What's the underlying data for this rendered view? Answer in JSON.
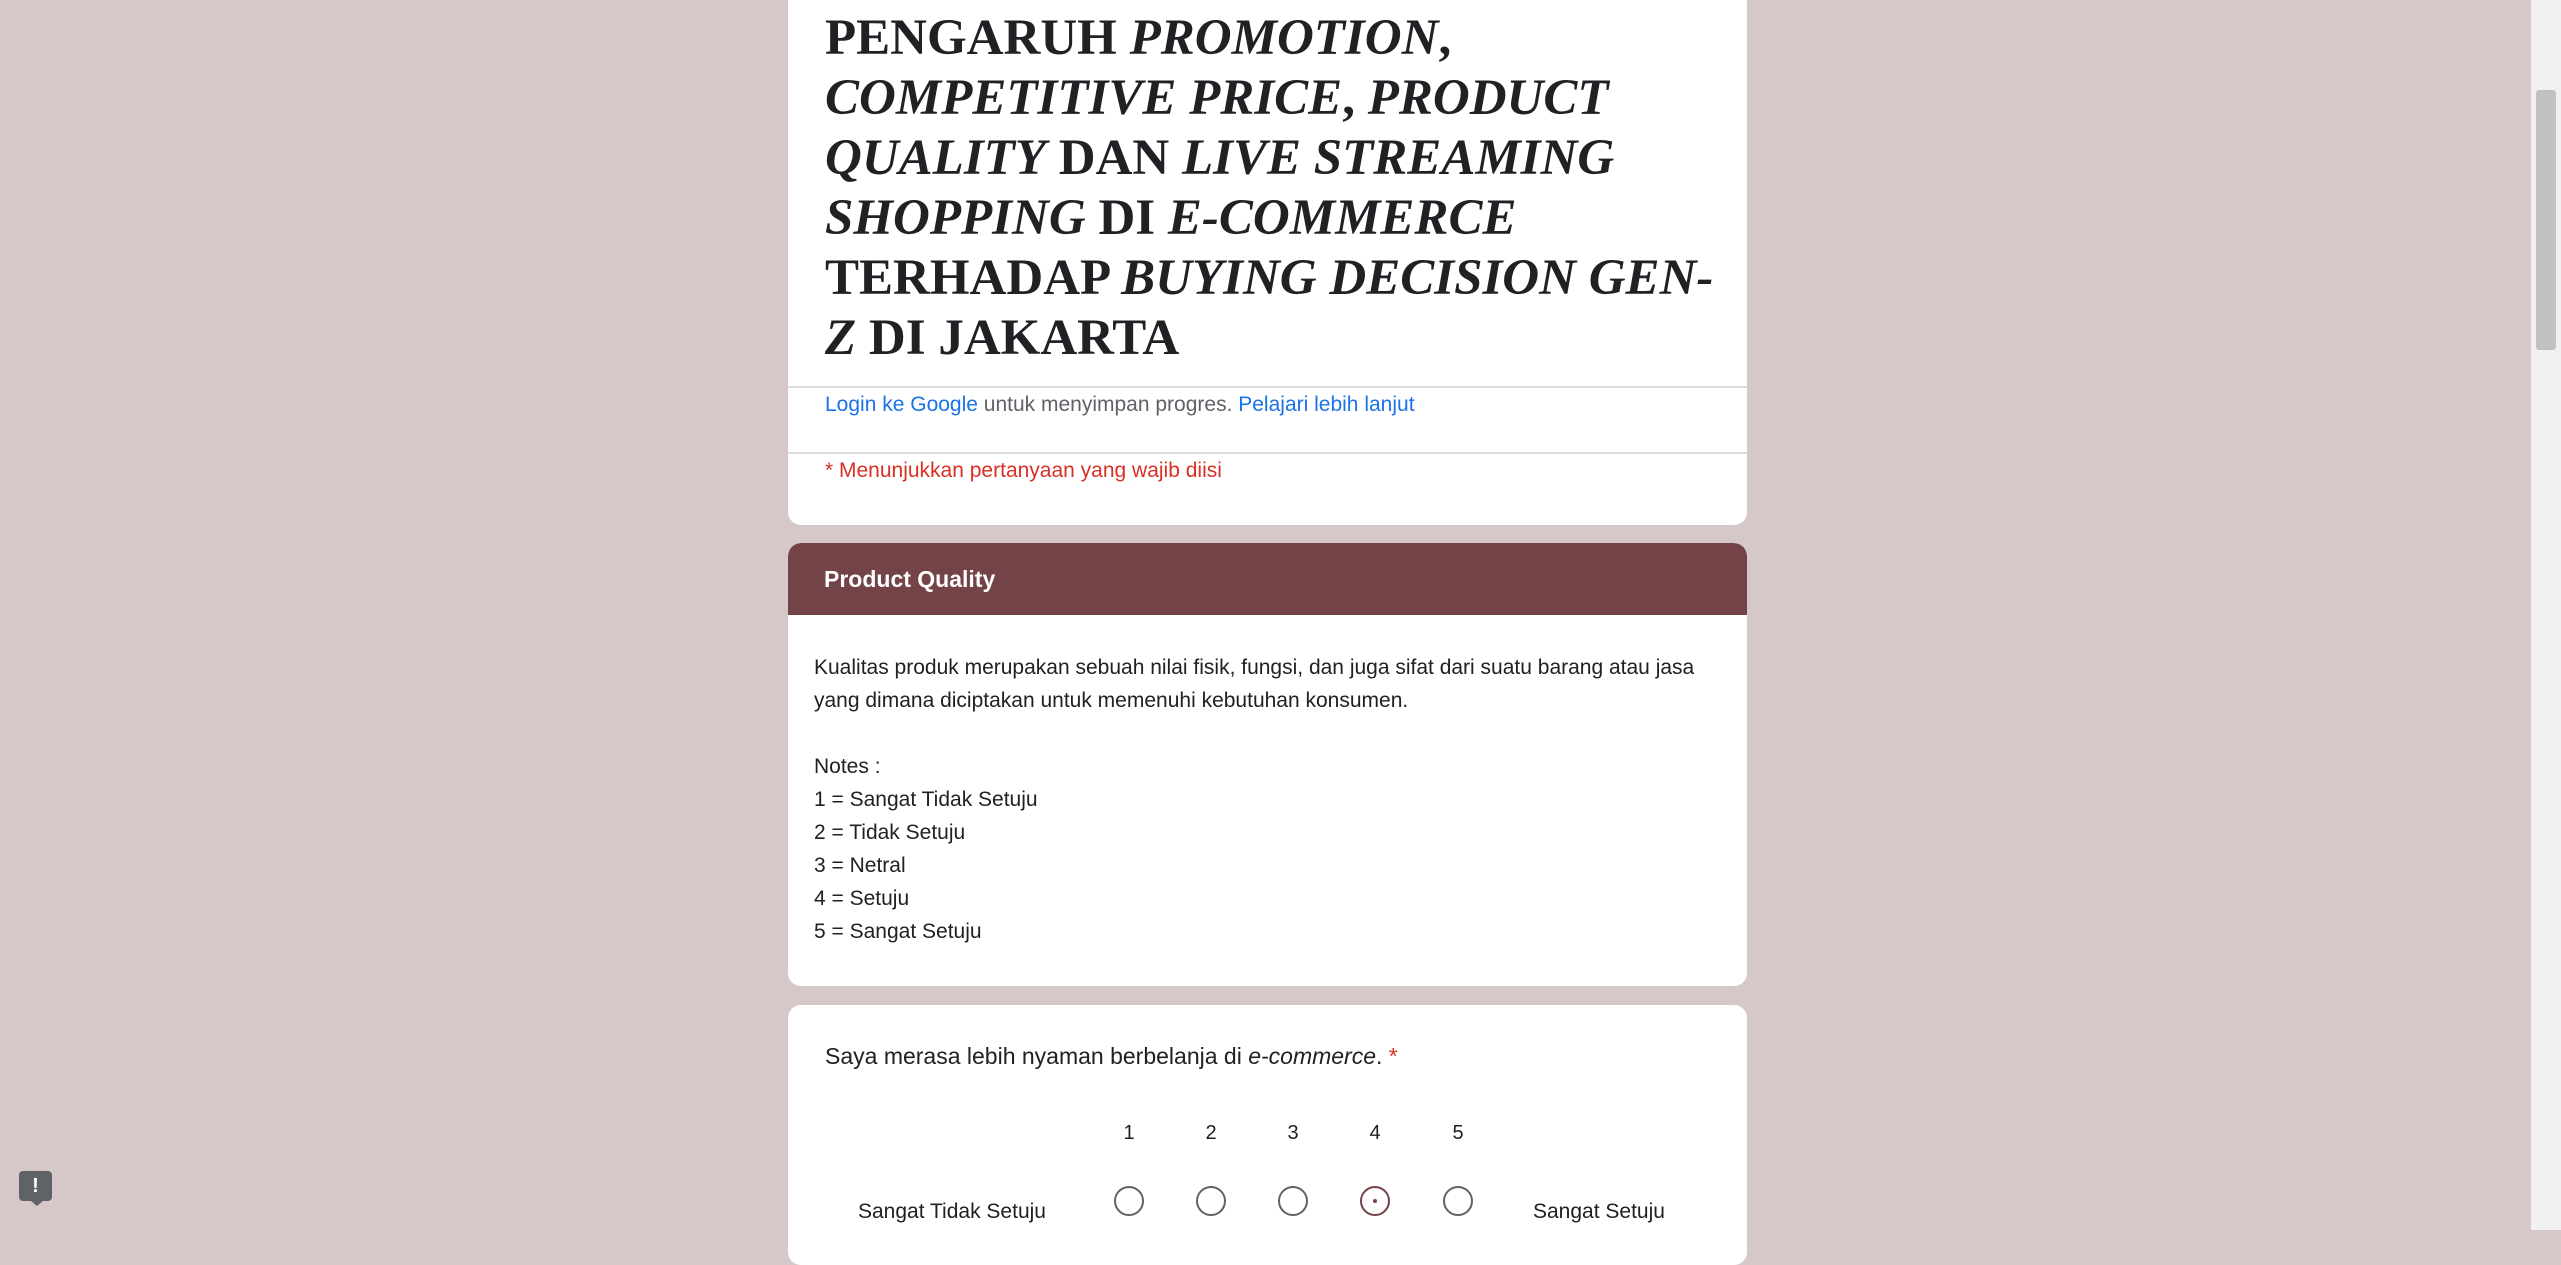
{
  "form": {
    "title_parts": [
      {
        "text": "PENGARUH ",
        "italic": false
      },
      {
        "text": "PROMOTION",
        "italic": true
      },
      {
        "text": ", ",
        "italic": false
      },
      {
        "text": "COMPETITIVE PRICE",
        "italic": true
      },
      {
        "text": ", ",
        "italic": false
      },
      {
        "text": "PRODUCT QUALITY",
        "italic": true
      },
      {
        "text": " DAN ",
        "italic": false
      },
      {
        "text": "LIVE STREAMING SHOPPING",
        "italic": true
      },
      {
        "text": " DI ",
        "italic": false
      },
      {
        "text": "E-COMMERCE",
        "italic": true
      },
      {
        "text": " TERHADAP ",
        "italic": false
      },
      {
        "text": "BUYING DECISION GEN-Z",
        "italic": true
      },
      {
        "text": " DI JAKARTA",
        "italic": false
      }
    ],
    "signin": {
      "login_link": "Login ke Google",
      "middle_text": " untuk menyimpan progres. ",
      "learn_more_link": "Pelajari lebih lanjut"
    },
    "required_note": "* Menunjukkan pertanyaan yang wajib diisi"
  },
  "section": {
    "title": "Product Quality",
    "description_lines": [
      "Kualitas produk merupakan sebuah nilai fisik, fungsi, dan juga sifat dari suatu barang atau jasa yang dimana diciptakan untuk memenuhi kebutuhan konsumen.",
      "",
      "Notes :",
      "1 = Sangat Tidak Setuju",
      "2 = Tidak Setuju",
      "3 = Netral",
      "4 = Setuju",
      "5 = Sangat Setuju"
    ]
  },
  "question": {
    "text_before": "Saya merasa lebih nyaman berbelanja di ",
    "text_italic": "e-commerce",
    "text_after": ".",
    "required_marker": "*",
    "scale_numbers": [
      "1",
      "2",
      "3",
      "4",
      "5"
    ],
    "selected_value": "4",
    "low_label": "Sangat Tidak Setuju",
    "high_label": "Sangat Setuju"
  },
  "feedback": {
    "icon": "report-feedback-icon",
    "glyph": "!"
  },
  "colors": {
    "background": "#d6c8c9",
    "theme": "#744347",
    "link": "#1a73e8",
    "required": "#d93025"
  }
}
